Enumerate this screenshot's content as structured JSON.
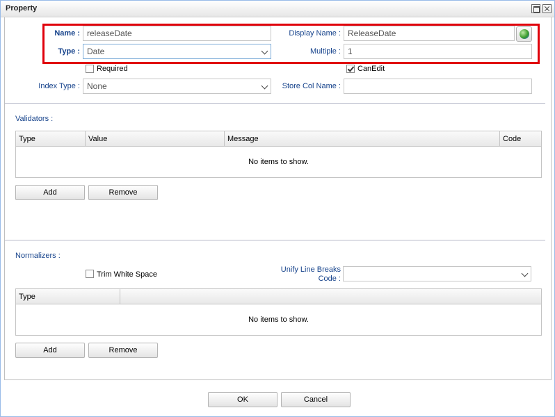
{
  "window": {
    "title": "Property"
  },
  "form": {
    "name_label": "Name :",
    "name_value": "releaseDate",
    "display_name_label": "Display Name :",
    "display_name_value": "ReleaseDate",
    "type_label": "Type :",
    "type_value": "Date",
    "multiple_label": "Multiple :",
    "multiple_value": "1",
    "required_label": "Required",
    "required_checked": false,
    "can_edit_label": "CanEdit",
    "can_edit_checked": true,
    "index_type_label": "Index Type :",
    "index_type_value": "None",
    "store_col_name_label": "Store Col Name :",
    "store_col_name_value": ""
  },
  "validators": {
    "title": "Validators :",
    "columns": [
      "Type",
      "Value",
      "Message",
      "Code"
    ],
    "empty_text": "No items to show.",
    "add_label": "Add",
    "remove_label": "Remove"
  },
  "normalizers": {
    "title": "Normalizers :",
    "trim_label": "Trim White Space",
    "trim_checked": false,
    "unify_label_line1": "Unify Line Breaks",
    "unify_label_line2": "Code :",
    "unify_value": "",
    "columns": [
      "Type",
      ""
    ],
    "empty_text": "No items to show.",
    "add_label": "Add",
    "remove_label": "Remove"
  },
  "footer": {
    "ok_label": "OK",
    "cancel_label": "Cancel"
  },
  "colors": {
    "label": "#15428b",
    "highlight": "#e0000b",
    "border": "#c6c6c6"
  },
  "icons": {
    "translate": "globe-icon",
    "maximize": "maximize-icon",
    "close": "close-icon",
    "dropdown": "chevron-down-icon"
  }
}
